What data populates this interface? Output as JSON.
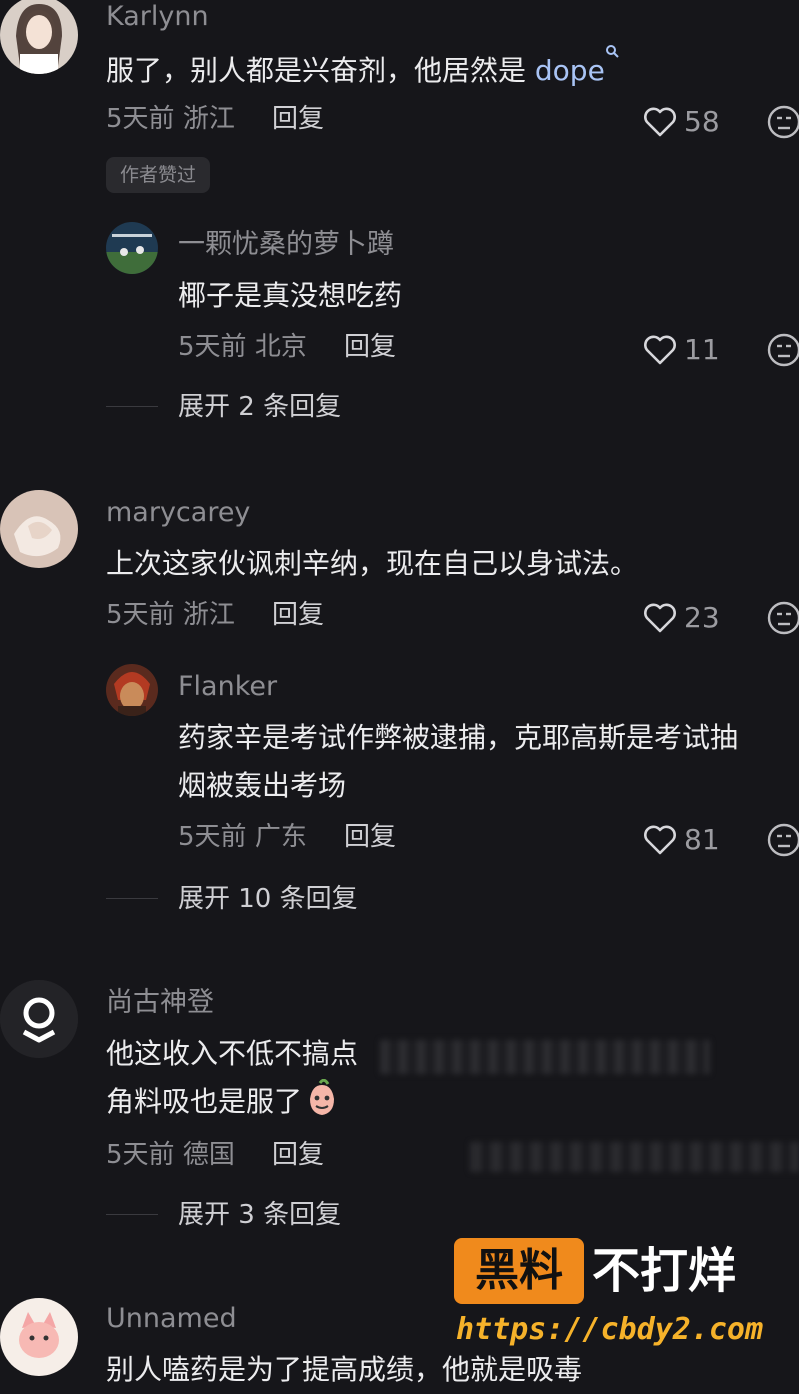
{
  "comments": [
    {
      "username": "Karlynn",
      "text_main": "服了，别人都是兴奋剂，他居然是 ",
      "text_link": "dope",
      "time": "5天前",
      "location": "浙江",
      "reply_label": "回复",
      "likes": "58",
      "badge": "作者赞过",
      "replies": [
        {
          "username": "一颗忧桑的萝卜蹲",
          "text": "椰子是真没想吃药",
          "time": "5天前",
          "location": "北京",
          "reply_label": "回复",
          "likes": "11"
        }
      ],
      "expand": "展开 2 条回复"
    },
    {
      "username": "marycarey",
      "text": "上次这家伙讽刺辛纳，现在自己以身试法。",
      "time": "5天前",
      "location": "浙江",
      "reply_label": "回复",
      "likes": "23",
      "replies": [
        {
          "username": "Flanker",
          "text_line1": "药家辛是考试作弊被逮捕，克耶高斯是考试抽",
          "text_line2": "烟被轰出考场",
          "time": "5天前",
          "location": "广东",
          "reply_label": "回复",
          "likes": "81"
        }
      ],
      "expand": "展开 10 条回复"
    },
    {
      "username": "尚古神登",
      "text_line1": "他这收入不低不搞点",
      "text_line2": "角料吸也是服了",
      "time": "5天前",
      "location": "德国",
      "reply_label": "回复",
      "expand": "展开 3 条回复"
    },
    {
      "username": "Unnamed",
      "text": "别人嗑药是为了提高成绩，他就是吸毒"
    }
  ],
  "watermark": {
    "box": "黑料",
    "text": "不打烊",
    "url": "https://cbdy2.com"
  },
  "colors": {
    "background": "#16161a",
    "text": "#ececee",
    "muted": "#8e8e93",
    "link": "#a9c4f5",
    "watermark_orange": "#f08a1c"
  }
}
